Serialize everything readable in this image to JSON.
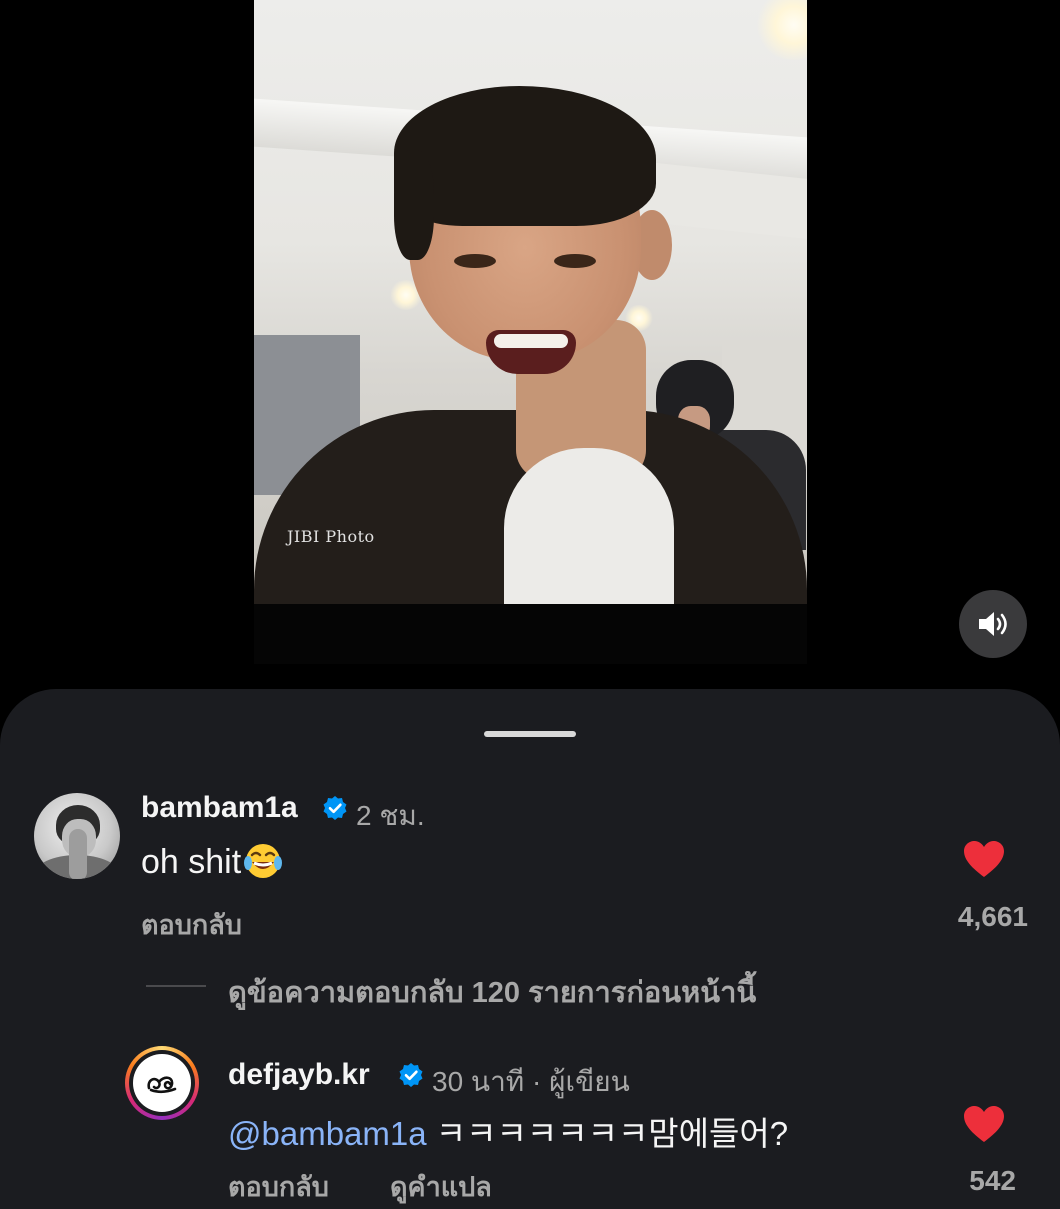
{
  "video": {
    "watermark": "JIBI Photo",
    "sound_icon": "speaker-icon"
  },
  "comments": [
    {
      "username": "bambam1a",
      "verified": true,
      "time": "2 ชม.",
      "text": "oh shit",
      "emoji": "face-with-tears-of-joy",
      "reply_label": "ตอบกลับ",
      "likes": "4,661",
      "liked": true
    }
  ],
  "view_replies_label": "ดูข้อความตอบกลับ 120 รายการก่อนหน้านี้",
  "reply": {
    "username": "defjayb.kr",
    "verified": true,
    "time": "30 นาที",
    "separator": "·",
    "author_label": "ผู้เขียน",
    "mention": "@bambam1a",
    "text": "ㅋㅋㅋㅋㅋㅋㅋ맘에들어?",
    "reply_label": "ตอบกลับ",
    "translate_label": "ดูคำแปล",
    "likes": "542",
    "liked": true
  },
  "colors": {
    "heart": "#ed2f3b",
    "verified": "#0095f6",
    "sheet_bg": "#1b1c20",
    "mention": "#8ab4f8"
  }
}
